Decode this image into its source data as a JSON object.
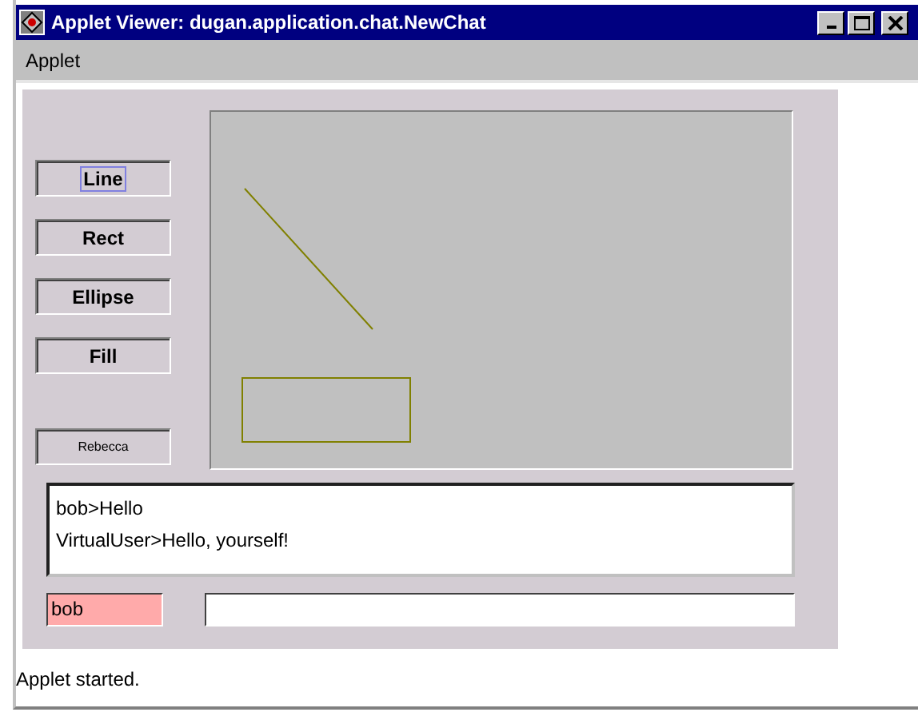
{
  "window": {
    "title": "Applet Viewer: dugan.application.chat.NewChat"
  },
  "menu": [
    "Applet"
  ],
  "tool_buttons": [
    {
      "label": "Line",
      "kind": "tool",
      "focused": true
    },
    {
      "label": "Rect",
      "kind": "tool",
      "focused": false
    },
    {
      "label": "Ellipse",
      "kind": "tool",
      "focused": false
    },
    {
      "label": "Fill",
      "kind": "tool",
      "focused": false
    },
    {
      "label": "Rebecca",
      "kind": "user",
      "focused": false
    }
  ],
  "chat_log": [
    "bob>Hello",
    "VirtualUser>Hello, yourself!"
  ],
  "name_field": {
    "value": "bob"
  },
  "status_bar": "Applet started."
}
